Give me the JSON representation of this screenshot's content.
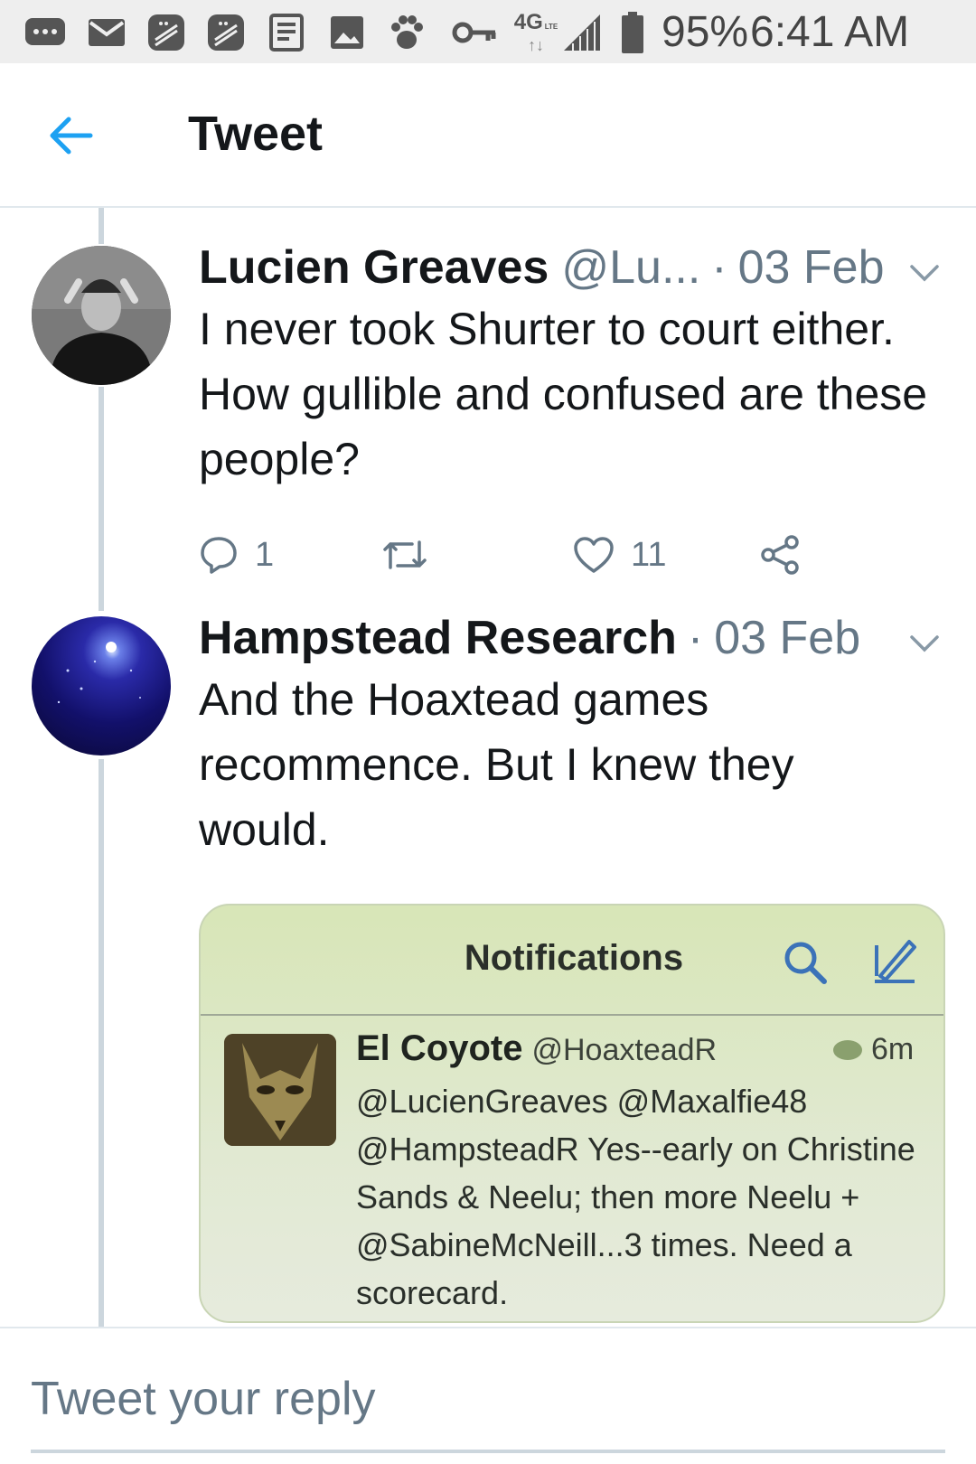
{
  "status_bar": {
    "battery_percent": "95%",
    "time": "6:41 AM",
    "network": "4G",
    "network_sub": "LTE",
    "icons": [
      "chat-bubble-icon",
      "mail-icon",
      "blackberry-icon",
      "blackberry-icon",
      "news-icon",
      "image-icon",
      "paw-icon",
      "key-icon",
      "network-icon",
      "signal-icon",
      "battery-icon"
    ]
  },
  "app_bar": {
    "title": "Tweet",
    "back_icon": "arrow-left-icon"
  },
  "tweets": [
    {
      "name": "Lucien Greaves",
      "handle": "@Lu...",
      "separator": "·",
      "date": "03 Feb",
      "text": "I never took Shurter to court either. How gullible and confused are these people?",
      "replies": "1",
      "retweets": "",
      "likes": "11"
    },
    {
      "name": "Hampstead Research",
      "separator": "·",
      "date": "03 Feb",
      "text": "And the Hoaxtead games recommence. But I knew they would.",
      "media": {
        "title": "Notifications",
        "name": "El Coyote",
        "handle": "@HoaxteadR",
        "time": "6m",
        "text": "@LucienGreaves @Maxalfie48 @HampsteadR Yes--early on Christine Sands & Neelu; then more Neelu + @SabineMcNeill...3 times. Need a scorecard."
      }
    }
  ],
  "reply_bar": {
    "placeholder": "Tweet your reply"
  },
  "colors": {
    "accent": "#1da1f2",
    "text_primary": "#14171a",
    "text_secondary": "#657786",
    "divider": "#e1e8ed"
  }
}
